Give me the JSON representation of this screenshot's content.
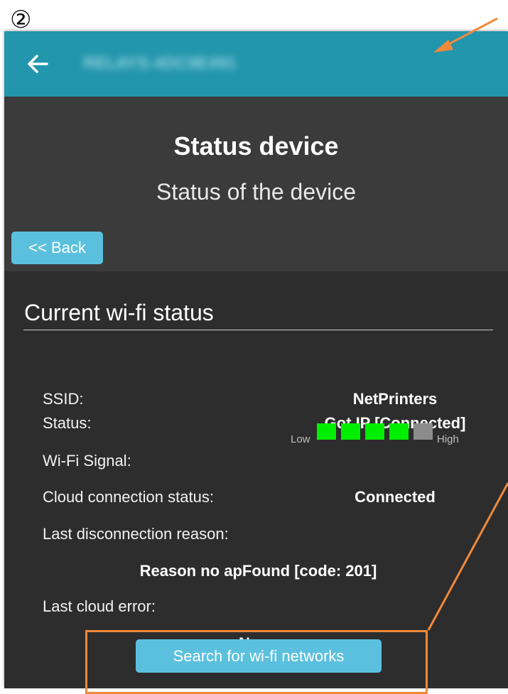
{
  "annotation": {
    "step_marker": "②",
    "accent": "#ef8a3c"
  },
  "appbar": {
    "back_icon": "arrow-left-icon",
    "device_name": "RELAYS-4DC9E491",
    "color": "#2296ad"
  },
  "header": {
    "title": "Status device",
    "subtitle": "Status of the device",
    "back_label": "<< Back"
  },
  "wifi": {
    "section_title": "Current wi-fi status",
    "ssid_label": "SSID:",
    "ssid_value": "NetPrinters",
    "status_label": "Status:",
    "status_value": "Got IP [Connected]",
    "signal_label": "Wi-Fi Signal:",
    "signal_low": "Low",
    "signal_high": "High",
    "signal_level": 4,
    "signal_max": 5,
    "signal_on_color": "#00ee00",
    "signal_off_color": "#8c8c8c",
    "cloud_label": "Cloud connection status:",
    "cloud_value": "Connected",
    "disconnect_label": "Last disconnection reason:",
    "disconnect_value": "Reason no apFound [code: 201]",
    "cloud_error_label": "Last cloud error:",
    "cloud_error_value": "None",
    "search_button": "Search for wi-fi networks"
  }
}
